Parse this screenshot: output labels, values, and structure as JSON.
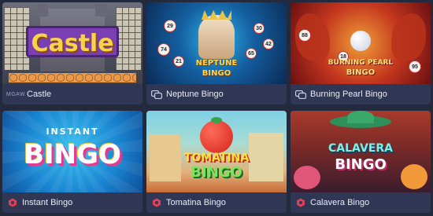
{
  "games": [
    {
      "name": "Castle",
      "provider_icon": "mgaw-logo",
      "provider_text": "MGAW",
      "art_title": "Castle"
    },
    {
      "name": "Neptune Bingo",
      "provider_icon": "bingo-provider-icon",
      "art_title": "NEPTUNE",
      "art_subtitle": "BINGO",
      "balls": [
        "29",
        "30",
        "74",
        "21",
        "65",
        "42"
      ]
    },
    {
      "name": "Burning Pearl Bingo",
      "provider_icon": "bingo-provider-icon",
      "art_title": "BURNING PEARL",
      "art_subtitle": "BINGO",
      "balls": [
        "88",
        "18",
        "95"
      ]
    },
    {
      "name": "Instant Bingo",
      "provider_icon": "spribe-icon",
      "art_title": "INSTANT",
      "art_subtitle": "BINGO"
    },
    {
      "name": "Tomatina Bingo",
      "provider_icon": "spribe-icon",
      "art_title": "TOMATINA",
      "art_subtitle": "BINGO"
    },
    {
      "name": "Calavera Bingo",
      "provider_icon": "spribe-icon",
      "art_title": "CALAVERA",
      "art_subtitle": "BINGO"
    }
  ],
  "colors": {
    "page_bg": "#232a3e",
    "caption_bg": "#2f3754",
    "caption_text": "#e8ecf5",
    "spribe_accent": "#e0405a"
  }
}
